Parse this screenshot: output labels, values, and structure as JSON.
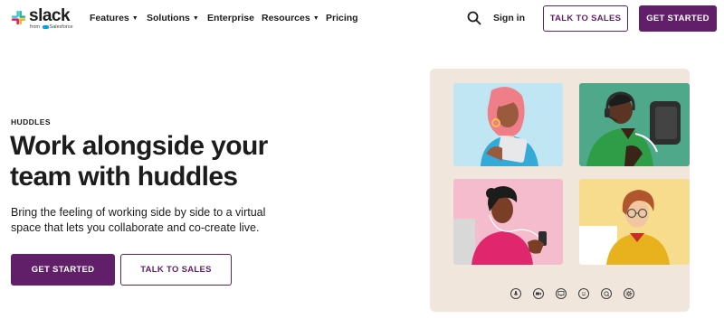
{
  "brand": {
    "wordmark": "slack",
    "sub": "from",
    "sub_brand": "Salesforce",
    "colors": {
      "aubergine": "#611f69",
      "text": "#1d1c1d",
      "illustration_bg": "#f0e6dc"
    }
  },
  "nav": {
    "items": [
      {
        "label": "Features",
        "has_dropdown": true
      },
      {
        "label": "Solutions",
        "has_dropdown": true
      },
      {
        "label": "Enterprise",
        "has_dropdown": false
      },
      {
        "label": "Resources",
        "has_dropdown": true
      },
      {
        "label": "Pricing",
        "has_dropdown": false
      }
    ],
    "search_icon": "search-icon",
    "sign_in": "Sign in",
    "talk_to_sales": "TALK TO SALES",
    "get_started": "GET STARTED"
  },
  "hero": {
    "eyebrow": "HUDDLES",
    "headline": "Work alongside your team with huddles",
    "subtext": "Bring the feeling of working side by side to a virtual space that lets you collaborate and co-create live.",
    "primary_cta": "GET STARTED",
    "secondary_cta": "TALK TO SALES"
  },
  "illustration": {
    "tile_colors": [
      "#bfe6f2",
      "#4ea889",
      "#f4bccd",
      "#f6dc8c"
    ],
    "controls": [
      "microphone-icon",
      "video-camera-icon",
      "screen-share-icon",
      "emoji-icon",
      "chat-bubble-icon",
      "settings-icon"
    ]
  }
}
